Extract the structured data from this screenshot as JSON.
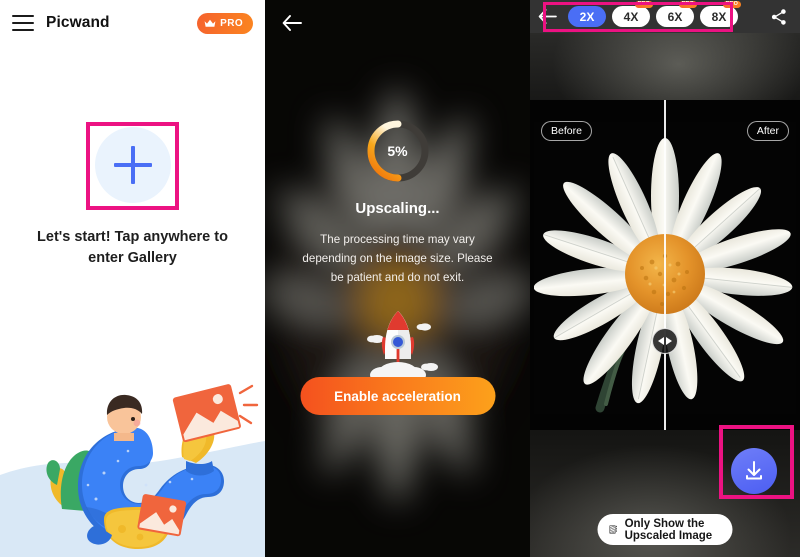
{
  "panel1": {
    "header": {
      "menu_icon": "hamburger-menu-icon",
      "app_title": "Picwand",
      "pro_badge": {
        "label": "PRO",
        "icon": "crown-icon",
        "color": "#f5622d"
      }
    },
    "add_button": {
      "icon": "plus-icon",
      "color": "#4a6ef5"
    },
    "caption": "Let's start! Tap anywhere to enter Gallery",
    "illustration": "person-with-photo-illustration",
    "highlight_color": "#ec1282"
  },
  "panel2": {
    "back_icon": "back-arrow-icon",
    "progress": {
      "percent_label": "5%",
      "value": 5,
      "color": "#f58220"
    },
    "status_title": "Upscaling...",
    "description": "The processing time may vary depending on the image size. Please be patient and do not exit.",
    "rocket_icon": "rocket-icon",
    "accelerate_button": "Enable acceleration"
  },
  "panel3": {
    "toolbar": {
      "back_icon": "back-arrow-icon",
      "share_icon": "share-icon",
      "scales": [
        {
          "label": "2X",
          "pro": false,
          "selected": true
        },
        {
          "label": "4X",
          "pro": true,
          "selected": false
        },
        {
          "label": "6X",
          "pro": true,
          "selected": false
        },
        {
          "label": "8X",
          "pro": true,
          "selected": false
        }
      ],
      "pro_label": "PRO"
    },
    "compare": {
      "before_label": "Before",
      "after_label": "After",
      "slider_icon": "compare-slider-handle-icon",
      "image": "daisy-flower-image"
    },
    "download_button": {
      "icon": "download-icon",
      "color": "#4c5ef2"
    },
    "only_upscaled_button": {
      "label": "Only Show the Upscaled Image",
      "icon": "image-hatch-icon"
    },
    "highlight_color": "#ec1282"
  }
}
